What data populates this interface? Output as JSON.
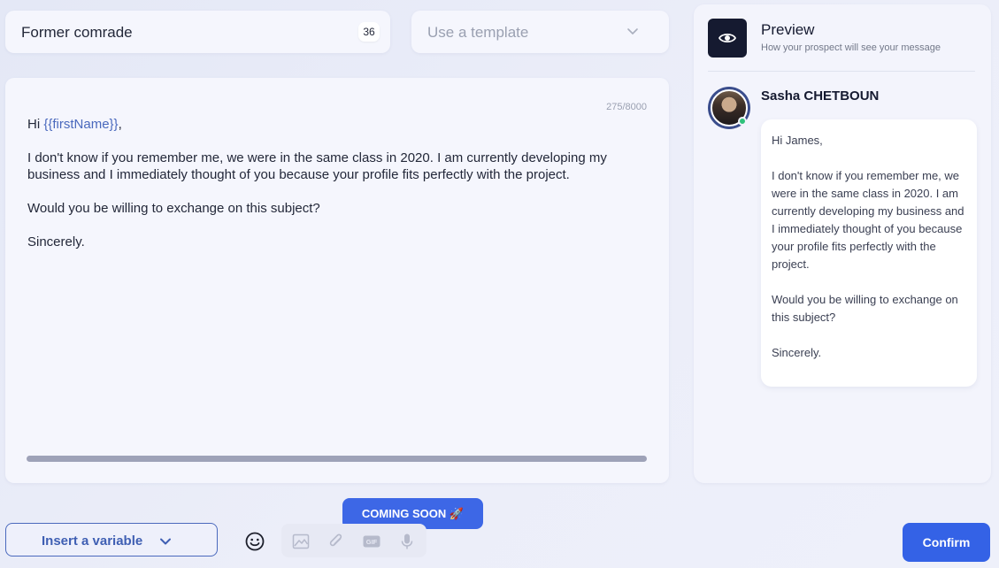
{
  "subject": {
    "value": "Former comrade",
    "char_count": "36"
  },
  "template": {
    "placeholder": "Use a template"
  },
  "editor": {
    "char_counter": "275/8000",
    "greeting_prefix": "Hi ",
    "greeting_variable": "{{firstName}}",
    "greeting_suffix": ",",
    "paragraph_1": "I don't know if you remember me, we were in the same class in 2020. I am currently developing my business and I immediately thought of you because your profile fits perfectly with the project.",
    "paragraph_2": "Would you be willing to exchange on this subject?",
    "closing": "Sincerely."
  },
  "preview": {
    "title": "Preview",
    "subtitle": "How your prospect will see your message",
    "sender_name": "Sasha CHETBOUN",
    "message": {
      "greeting": "Hi James,",
      "paragraph_1": "I don't know if you remember me, we were in the same class in 2020. I am currently developing my business and I immediately thought of you because your profile fits perfectly with the project.",
      "paragraph_2": "Would you be willing to exchange on this subject?",
      "closing": "Sincerely."
    }
  },
  "toolbar": {
    "coming_soon_label": "COMING SOON 🚀",
    "insert_variable_label": "Insert a variable",
    "confirm_label": "Confirm",
    "icons": [
      "emoji-icon",
      "image-icon",
      "paperclip-icon",
      "gif-icon",
      "microphone-icon"
    ]
  },
  "colors": {
    "accent": "#3462e6",
    "variable": "#4a69bd",
    "online": "#2fc27b"
  }
}
